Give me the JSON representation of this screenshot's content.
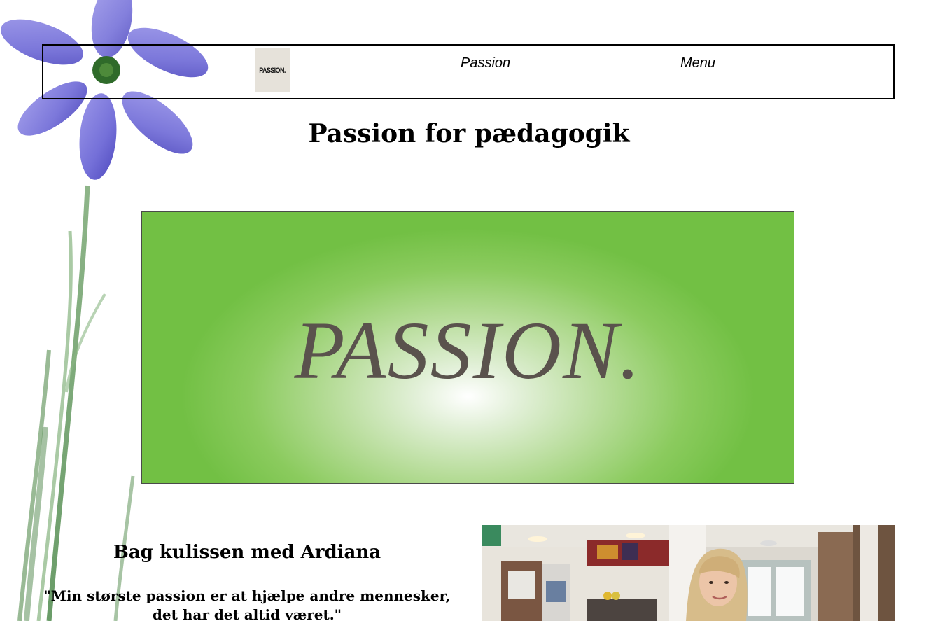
{
  "nav": {
    "logo_text": "PASSION.",
    "links": [
      {
        "label": "Passion"
      },
      {
        "label": "Menu"
      }
    ]
  },
  "hero": {
    "title": "Passion for pædagogik",
    "banner_text": "PASSION."
  },
  "about": {
    "title": "Bag kulissen med Ardiana",
    "quote": "\"Min største passion er at hjælpe andre mennesker, det har det altid været.\""
  },
  "colors": {
    "banner_green": "#72c044",
    "banner_text": "#5a524d",
    "flower_petal": "#6f6ad6",
    "stem_green": "#6f9e6a"
  },
  "icons": {
    "background": "flower-illustration",
    "photo": "person-photo"
  }
}
